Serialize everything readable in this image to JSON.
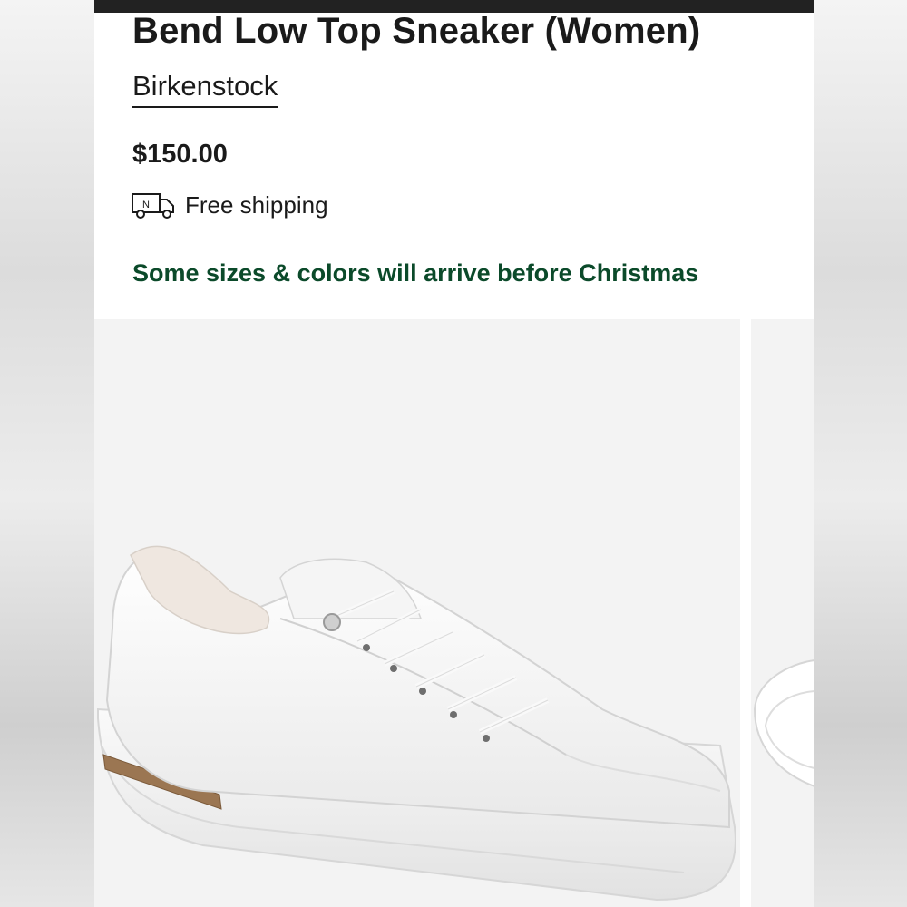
{
  "product": {
    "title": "Bend Low Top Sneaker (Women)",
    "brand": "Birkenstock",
    "price": "$150.00"
  },
  "shipping": {
    "icon": "delivery-truck-icon",
    "truck_badge": "N",
    "text": "Free shipping"
  },
  "promo": {
    "text": "Some sizes & colors will arrive before Christmas",
    "color": "#0b4a2a"
  },
  "gallery": {
    "main_image": "white-leather-sneaker-image",
    "next_image": "sneaker-image-next"
  },
  "colors": {
    "top_bar": "#222222",
    "text": "#1a1a1a",
    "image_bg": "#f3f3f3"
  }
}
